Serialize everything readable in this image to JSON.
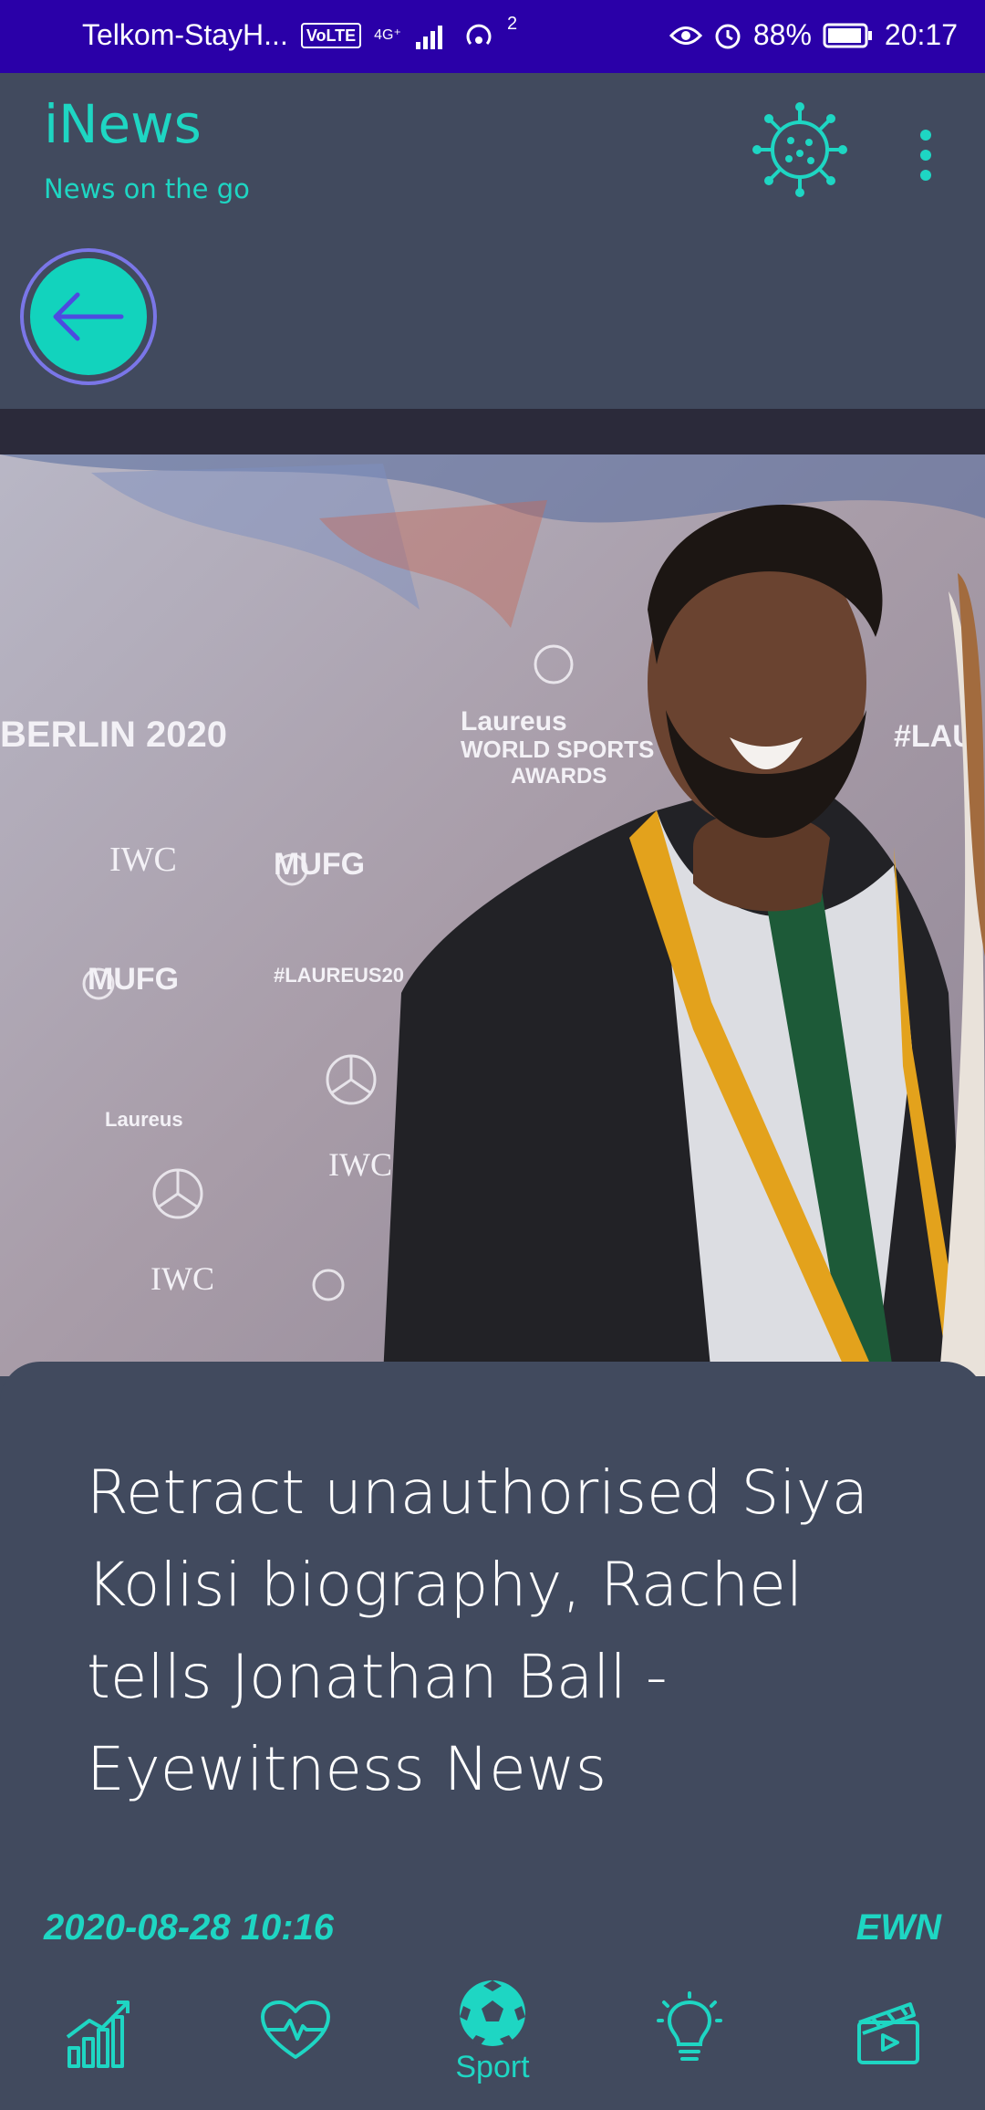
{
  "status": {
    "carrier": "Telkom-StayH...",
    "volte": "VoLTE",
    "network": "4G⁺",
    "hotspot_count": "2",
    "battery": "88%",
    "time": "20:17"
  },
  "app": {
    "title": "iNews",
    "subtitle": "News on the go"
  },
  "photo": {
    "backdrop_texts": [
      "BERLIN 2020",
      "Laureus",
      "WORLD SPORTS",
      "AWARDS",
      "IWC",
      "MUFG",
      "#LAUREUS20",
      "#LAU"
    ]
  },
  "article": {
    "headline": "Retract unauthorised Siya Kolisi biography, Rachel tells Jonathan Ball - Eyewitness News",
    "date": "2020-08-28 10:16",
    "source": "EWN"
  },
  "nav": {
    "items": [
      {
        "icon": "chart-growth-icon",
        "label": ""
      },
      {
        "icon": "heartbeat-icon",
        "label": ""
      },
      {
        "icon": "soccer-ball-icon",
        "label": "Sport"
      },
      {
        "icon": "lightbulb-icon",
        "label": ""
      },
      {
        "icon": "clapperboard-icon",
        "label": ""
      }
    ]
  },
  "colors": {
    "accent": "#1ed6c3",
    "status_bar": "#2a00a8",
    "background": "#414a5e",
    "back_ring": "#7a76e8"
  }
}
